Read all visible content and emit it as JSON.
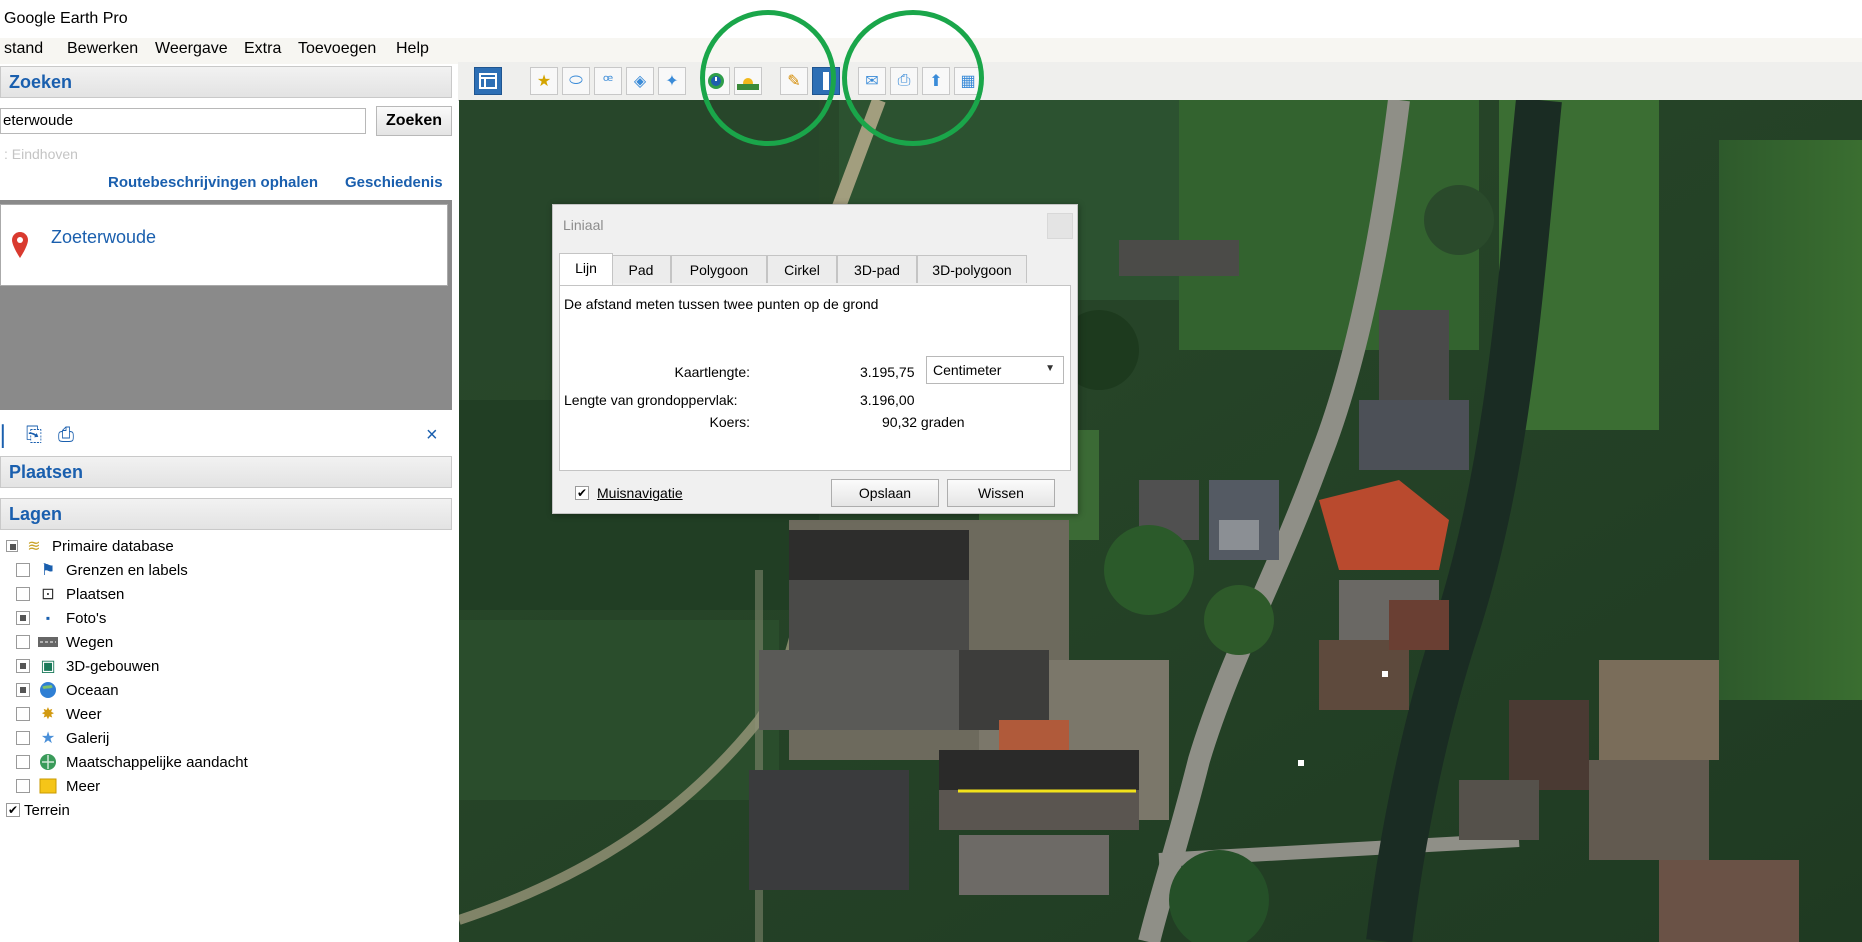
{
  "app": {
    "title": "Google Earth Pro"
  },
  "menu": [
    "stand",
    "Bewerken",
    "Weergave",
    "Extra",
    "Toevoegen",
    "Help"
  ],
  "search": {
    "header": "Zoeken",
    "query": "eterwoude",
    "button": "Zoeken",
    "hint": ": Eindhoven",
    "route_link": "Routebeschrijvingen ophalen",
    "history_link": "Geschiedenis",
    "result": "Zoeterwoude"
  },
  "panels": {
    "places": "Plaatsen",
    "layers": "Lagen",
    "close_glyph": "×"
  },
  "layers": [
    {
      "label": "Primaire database",
      "state": "partial",
      "icon": "database-icon"
    },
    {
      "label": "Grenzen en labels",
      "state": "unchecked",
      "icon": "flag-icon"
    },
    {
      "label": "Plaatsen",
      "state": "unchecked",
      "icon": "places-icon"
    },
    {
      "label": "Foto's",
      "state": "partial",
      "icon": "photo-icon"
    },
    {
      "label": "Wegen",
      "state": "unchecked",
      "icon": "road-icon"
    },
    {
      "label": "3D-gebouwen",
      "state": "partial",
      "icon": "building-icon"
    },
    {
      "label": "Oceaan",
      "state": "partial",
      "icon": "globe-icon"
    },
    {
      "label": "Weer",
      "state": "unchecked",
      "icon": "sun-icon"
    },
    {
      "label": "Galerij",
      "state": "unchecked",
      "icon": "star-icon"
    },
    {
      "label": "Maatschappelijke aandacht",
      "state": "unchecked",
      "icon": "globe-icon"
    },
    {
      "label": "Meer",
      "state": "unchecked",
      "icon": "folder-icon"
    },
    {
      "label": "Terrein",
      "state": "checked",
      "icon": ""
    }
  ],
  "ruler": {
    "title": "Liniaal",
    "tabs": [
      "Lijn",
      "Pad",
      "Polygoon",
      "Cirkel",
      "3D-pad",
      "3D-polygoon"
    ],
    "description": "De afstand meten tussen twee punten op de grond",
    "map_length_label": "Kaartlengte:",
    "map_length_value": "3.195,75",
    "unit": "Centimeter",
    "ground_length_label": "Lengte van grondoppervlak:",
    "ground_length_value": "3.196,00",
    "heading_label": "Koers:",
    "heading_value": "90,32 graden",
    "mouse_nav_label": "Muisnavigatie",
    "save_label": "Opslaan",
    "clear_label": "Wissen"
  },
  "colors": {
    "link": "#1a5fae",
    "highlight_circle": "#1aa64a",
    "measure_line": "#f2e21a"
  }
}
